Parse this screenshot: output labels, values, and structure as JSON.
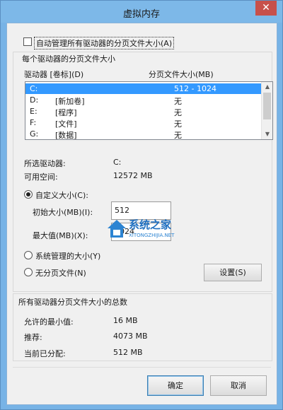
{
  "title": "虚拟内存",
  "close_glyph": "✕",
  "auto_manage_label": "自动管理所有驱动器的分页文件大小(A)",
  "per_drive_group_label": "每个驱动器的分页文件大小",
  "columns": {
    "drive": "驱动器 [卷标](D)",
    "size": "分页文件大小(MB)"
  },
  "drives": [
    {
      "drive": "C:",
      "label": "",
      "size": "512 - 1024",
      "selected": true
    },
    {
      "drive": "D:",
      "label": "[新加卷]",
      "size": "无",
      "selected": false
    },
    {
      "drive": "E:",
      "label": "[程序]",
      "size": "无",
      "selected": false
    },
    {
      "drive": "F:",
      "label": "[文件]",
      "size": "无",
      "selected": false
    },
    {
      "drive": "G:",
      "label": "[数据]",
      "size": "无",
      "selected": false
    }
  ],
  "selected_drive": {
    "label": "所选驱动器:",
    "value": "C:"
  },
  "free_space": {
    "label": "可用空间:",
    "value": "12572 MB"
  },
  "custom_size_label": "自定义大小(C):",
  "initial_size": {
    "label": "初始大小(MB)(I):",
    "value": "512"
  },
  "max_size": {
    "label": "最大值(MB)(X):",
    "value": "1024"
  },
  "system_managed_label": "系统管理的大小(Y)",
  "no_paging_label": "无分页文件(N)",
  "set_button": "设置(S)",
  "totals_group_label": "所有驱动器分页文件大小的总数",
  "minimum_allowed": {
    "label": "允许的最小值:",
    "value": "16 MB"
  },
  "recommended": {
    "label": "推荐:",
    "value": "4073 MB"
  },
  "currently_allocated": {
    "label": "当前已分配:",
    "value": "512 MB"
  },
  "ok_button": "确定",
  "cancel_button": "取消",
  "watermark": {
    "text": "系统之家",
    "sub": "XITONGZHIJIA.NET"
  }
}
